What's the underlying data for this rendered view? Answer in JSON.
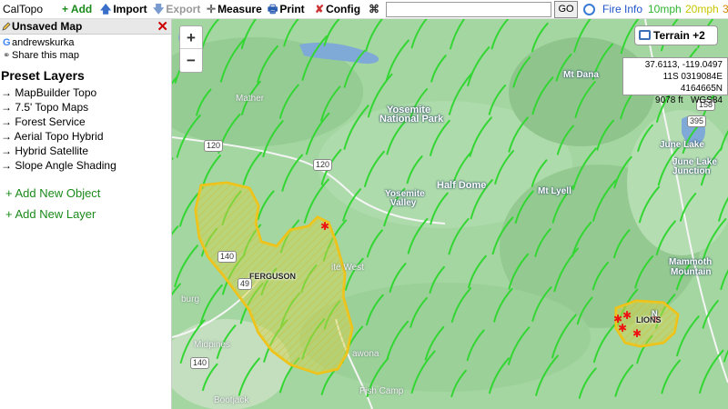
{
  "toolbar": {
    "app_name": "CalTopo",
    "add": "+ Add",
    "import": "Import",
    "export": "Export",
    "measure": "Measure",
    "print": "Print",
    "config": "Config",
    "search_value": "",
    "go": "GO",
    "fire_info": "Fire Info",
    "wind_10": "10mph",
    "wind_20": "20mph",
    "wind_30": "3",
    "colors": {
      "add": "#1a8a1a",
      "fire_info": "#2255cc",
      "wind_10": "#2fb52f",
      "wind_20": "#c6c600"
    }
  },
  "sidebar": {
    "map_title": "Unsaved Map",
    "user": "andrewskurka",
    "share": "Share this map",
    "preset_title": "Preset Layers",
    "presets": [
      "MapBuilder Topo",
      "7.5' Topo Maps",
      "Forest Service",
      "Aerial Topo Hybrid",
      "Hybrid Satellite",
      "Slope Angle Shading"
    ],
    "add_object": "+ Add New Object",
    "add_layer": "+ Add New Layer"
  },
  "map": {
    "zoom_in": "+",
    "zoom_out": "−",
    "terrain_label": "Terrain +2",
    "coords": {
      "latlon": "37.6113, -119.0497",
      "utm": "11S 0319084E 4164665N",
      "elev": "9078 ft",
      "datum": "WGS84"
    },
    "labels": {
      "yosemite_np": "Yosemite",
      "yosemite_np2": "National Park",
      "half_dome": "Half Dome",
      "mt_dana": "Mt Dana",
      "mt_lyell": "Mt Lyell",
      "mather": "Mather",
      "yosemite_valley": "Yosemite",
      "yosemite_valley2": "Valley",
      "june_lake": "June Lake",
      "june_lake_jct": "June Lake",
      "june_lake_jct2": "Junction",
      "mammoth": "Mammoth",
      "mammoth2": "Mountain",
      "ferguson": "FERGUSON",
      "lions": "LIONS",
      "yosemite_west": "ite West",
      "midpines": "Midpines",
      "wawona": "awona",
      "fish_camp": "Fish Camp",
      "bootjack": "Bootjack",
      "mariposa": "burg",
      "n_lbl": "N"
    },
    "roads": [
      "120",
      "120",
      "140",
      "140",
      "49",
      "395",
      "158"
    ],
    "colors": {
      "terrain": "#9ed49b",
      "wind": "#33d633",
      "fire_fill": "#d6d34a",
      "fire_edge": "#f2c012",
      "fire_point": "#e11"
    }
  }
}
